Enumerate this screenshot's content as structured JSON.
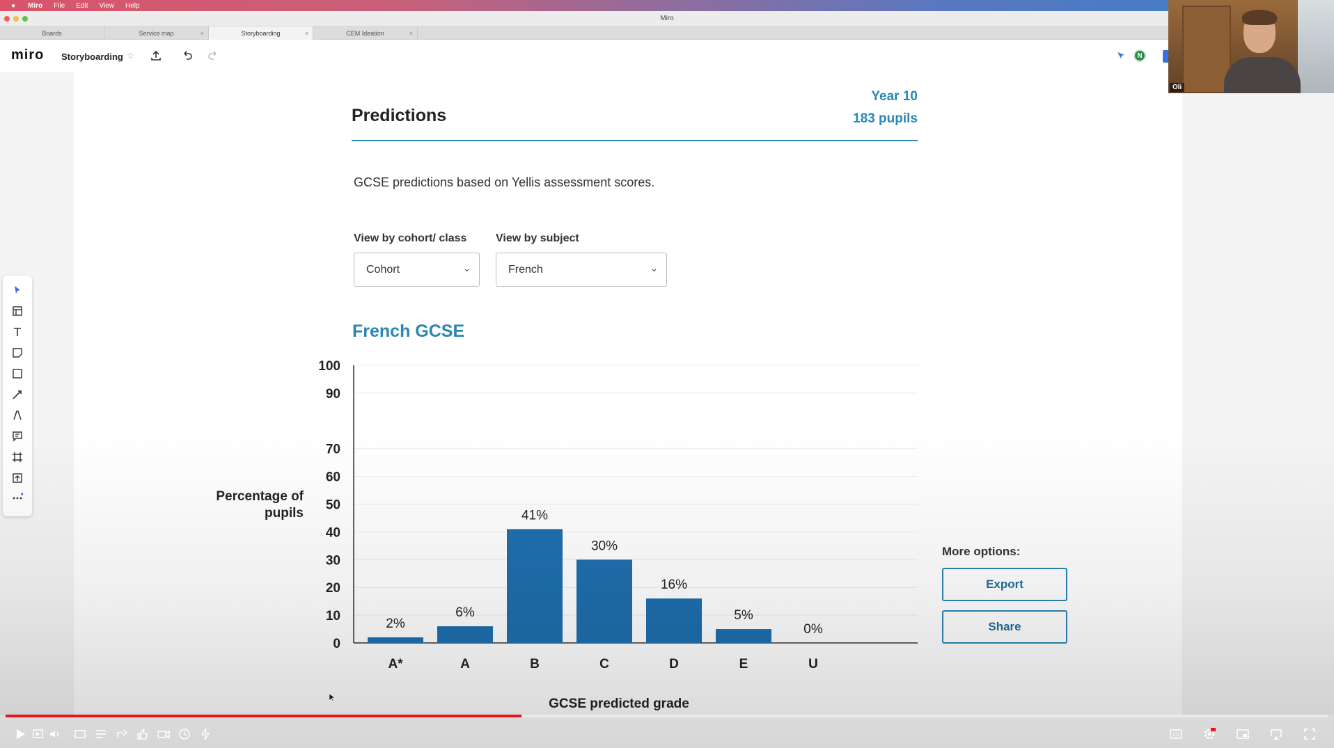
{
  "menubar": {
    "app_name": "Miro",
    "items": [
      "File",
      "Edit",
      "View",
      "Help"
    ]
  },
  "window": {
    "title": "Miro"
  },
  "tabs": [
    {
      "label": "Boards",
      "active": false
    },
    {
      "label": "Service map",
      "active": false
    },
    {
      "label": "Storyboarding",
      "active": true
    },
    {
      "label": "CEM Ideation",
      "active": false
    }
  ],
  "toolbar": {
    "logo": "miro",
    "board_name": "Storyboarding",
    "avatar_initial": "N"
  },
  "webcam": {
    "name": "Oli"
  },
  "page": {
    "title": "Predictions",
    "year": "Year 10",
    "pupils": "183 pupils",
    "description": "GCSE predictions based on Yellis assessment scores.",
    "cohort_label": "View by cohort/ class",
    "cohort_value": "Cohort",
    "subject_label": "View by subject",
    "subject_value": "French",
    "accent_color": "#2a86b4"
  },
  "chart_data": {
    "type": "bar",
    "title": "French GCSE",
    "xlabel": "GCSE predicted grade",
    "ylabel": "Percentage of pupils",
    "categories": [
      "A*",
      "A",
      "B",
      "C",
      "D",
      "E",
      "U"
    ],
    "values": [
      2,
      6,
      41,
      30,
      16,
      5,
      0
    ],
    "data_labels": [
      "2%",
      "6%",
      "41%",
      "30%",
      "16%",
      "5%",
      "0%"
    ],
    "y_ticks": [
      0,
      10,
      20,
      30,
      40,
      50,
      60,
      70,
      90,
      100
    ],
    "ylim": [
      0,
      100
    ],
    "bar_color": "#1f6fae",
    "grid": true
  },
  "more_options": {
    "label": "More options:",
    "export_label": "Export",
    "share_label": "Share"
  },
  "player": {
    "progress": 0.39,
    "progress_color": "#e5171b"
  }
}
